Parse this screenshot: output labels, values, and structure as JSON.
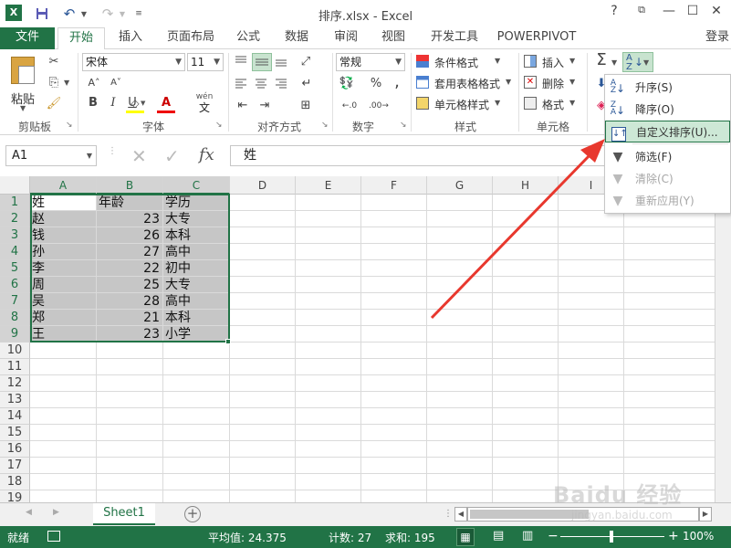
{
  "titlebar": {
    "title": "排序.xlsx - Excel",
    "app_icon": "excel-icon",
    "help": "?",
    "login": "登录"
  },
  "tabs": [
    "文件",
    "开始",
    "插入",
    "页面布局",
    "公式",
    "数据",
    "审阅",
    "视图",
    "开发工具",
    "POWERPIVOT"
  ],
  "ribbon": {
    "clipboard": {
      "paste": "粘贴",
      "label": "剪贴板"
    },
    "font": {
      "name": "宋体",
      "size": "11",
      "label": "字体",
      "bold": "B",
      "italic": "I",
      "underline": "U",
      "wen": "wén",
      "wen_char": "文"
    },
    "align": {
      "label": "对齐方式"
    },
    "number": {
      "format": "常规",
      "label": "数字",
      "percent": "%",
      "comma": ",",
      "dec_more": "⁺⁰₀",
      "dec_less": "⁰₀"
    },
    "styles": {
      "cond": "条件格式",
      "table": "套用表格格式",
      "cell": "单元格样式",
      "label": "样式"
    },
    "cells": {
      "insert": "插入",
      "delete": "删除",
      "format": "格式",
      "label": "单元格"
    },
    "editing": {
      "sigma": "Σ",
      "sort": "A↓Z"
    }
  },
  "formula_bar": {
    "namebox": "A1",
    "fx": "fx",
    "content": "姓"
  },
  "grid": {
    "columns": [
      "A",
      "B",
      "C",
      "D",
      "E",
      "F",
      "G",
      "H",
      "I"
    ],
    "rows": [
      "1",
      "2",
      "3",
      "4",
      "5",
      "6",
      "7",
      "8",
      "9",
      "10",
      "11",
      "12",
      "13",
      "14",
      "15",
      "16",
      "17",
      "18",
      "19"
    ],
    "data": [
      [
        "姓",
        "年龄",
        "学历"
      ],
      [
        "赵",
        "23",
        "大专"
      ],
      [
        "钱",
        "26",
        "本科"
      ],
      [
        "孙",
        "27",
        "高中"
      ],
      [
        "李",
        "22",
        "初中"
      ],
      [
        "周",
        "25",
        "大专"
      ],
      [
        "吴",
        "28",
        "高中"
      ],
      [
        "郑",
        "21",
        "本科"
      ],
      [
        "王",
        "23",
        "小学"
      ]
    ]
  },
  "sheet_tabs": {
    "active": "Sheet1",
    "add": "+"
  },
  "statusbar": {
    "ready": "就绪",
    "average": "平均值: 24.375",
    "count": "计数: 27",
    "sum": "求和: 195",
    "zoom": "100%",
    "minus": "−",
    "plus": "+"
  },
  "sort_menu": [
    {
      "label": "升序(S)",
      "icon": "sort-ascending-icon",
      "state": "normal"
    },
    {
      "label": "降序(O)",
      "icon": "sort-descending-icon",
      "state": "normal"
    },
    {
      "label": "自定义排序(U)...",
      "icon": "custom-sort-icon",
      "state": "highlighted"
    },
    {
      "label": "筛选(F)",
      "icon": "filter-icon",
      "state": "normal"
    },
    {
      "label": "清除(C)",
      "icon": "clear-filter-icon",
      "state": "disabled"
    },
    {
      "label": "重新应用(Y)",
      "icon": "reapply-icon",
      "state": "disabled"
    }
  ],
  "watermark": {
    "text": "Baidu 经验",
    "sub": "jingyan.baidu.com"
  },
  "colors": {
    "excel_green": "#217346",
    "selection_fill": "#c6c6c6",
    "arrow_red": "#e8382e",
    "menu_highlight": "#cde8d6"
  }
}
